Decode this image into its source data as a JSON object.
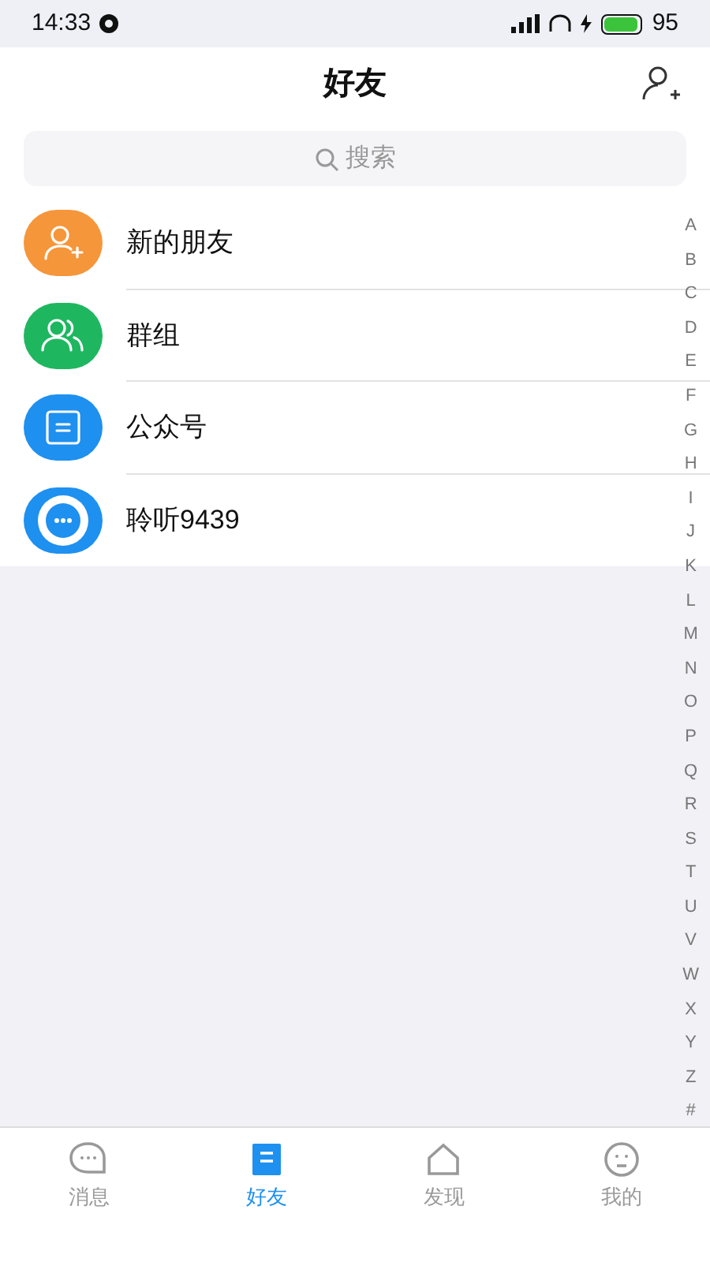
{
  "status_bar": {
    "time": "14:33",
    "battery": "95"
  },
  "header": {
    "title": "好友"
  },
  "search": {
    "placeholder": "搜索"
  },
  "entries": [
    {
      "kind": "add-friend",
      "label": "新的朋友",
      "color": "#f5963a"
    },
    {
      "kind": "group",
      "label": "群组",
      "color": "#1eb760"
    },
    {
      "kind": "official",
      "label": "公众号",
      "color": "#1e90f0"
    },
    {
      "kind": "chat-app",
      "label": "聆听9439",
      "color": "#1e90f0"
    }
  ],
  "index_letters": [
    "A",
    "B",
    "C",
    "D",
    "E",
    "F",
    "G",
    "H",
    "I",
    "J",
    "K",
    "L",
    "M",
    "N",
    "O",
    "P",
    "Q",
    "R",
    "S",
    "T",
    "U",
    "V",
    "W",
    "X",
    "Y",
    "Z",
    "#"
  ],
  "tabs": [
    {
      "kind": "chat",
      "label": "消息",
      "selected": false
    },
    {
      "kind": "contacts",
      "label": "好友",
      "selected": true
    },
    {
      "kind": "discover",
      "label": "发现",
      "selected": false
    },
    {
      "kind": "me",
      "label": "我的",
      "selected": false
    }
  ]
}
